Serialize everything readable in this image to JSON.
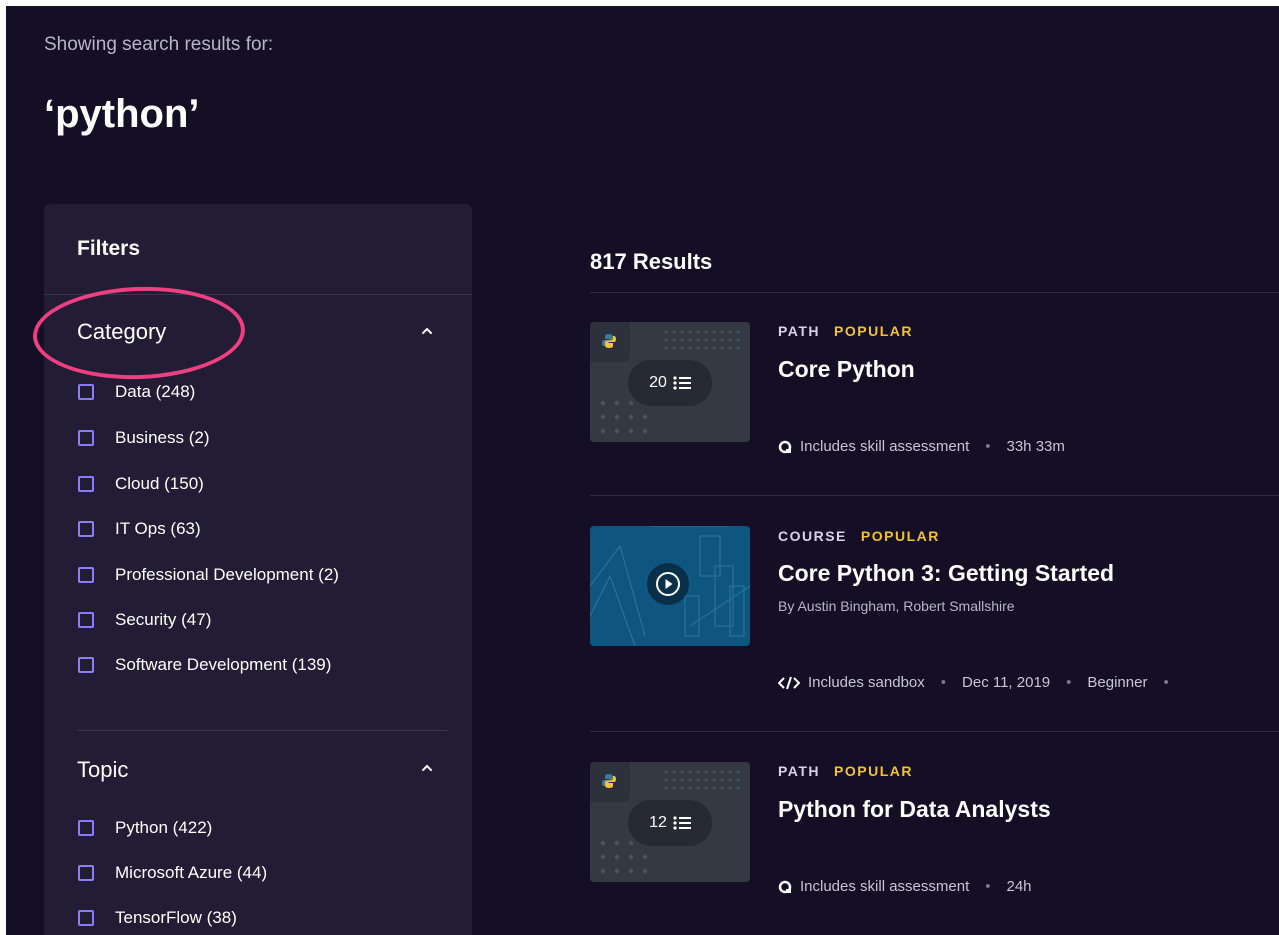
{
  "search": {
    "label": "Showing search results for:",
    "query": "‘python’"
  },
  "filters": {
    "title": "Filters",
    "sections": [
      {
        "title": "Category",
        "options": [
          {
            "label": "Data (248)"
          },
          {
            "label": "Business (2)"
          },
          {
            "label": "Cloud (150)"
          },
          {
            "label": "IT Ops (63)"
          },
          {
            "label": "Professional Development (2)"
          },
          {
            "label": "Security (47)"
          },
          {
            "label": "Software Development (139)"
          }
        ]
      },
      {
        "title": "Topic",
        "options": [
          {
            "label": "Python (422)"
          },
          {
            "label": "Microsoft Azure (44)"
          },
          {
            "label": "TensorFlow (38)"
          }
        ]
      }
    ]
  },
  "results": {
    "count_label": "817 Results",
    "items": [
      {
        "type": "PATH",
        "badge": "POPULAR",
        "title": "Core Python",
        "thumb_count": "20",
        "info": [
          "Includes skill assessment",
          "33h 33m"
        ]
      },
      {
        "type": "COURSE",
        "badge": "POPULAR",
        "title": "Core Python 3: Getting Started",
        "authors": "By Austin Bingham, Robert Smallshire",
        "info": [
          "Includes sandbox",
          "Dec 11, 2019",
          "Beginner"
        ]
      },
      {
        "type": "PATH",
        "badge": "POPULAR",
        "title": "Python for Data Analysts",
        "thumb_count": "12",
        "info": [
          "Includes skill assessment",
          "24h"
        ]
      }
    ]
  },
  "colors": {
    "background": "#140f24",
    "panel": "#221c35",
    "accent": "#8a7dff",
    "popular": "#f2c230",
    "highlight": "#ee3f82"
  },
  "icons": {
    "chevron": "chevron-up-icon",
    "python": "python-logo-icon",
    "list": "list-icon",
    "play": "play-icon",
    "assessment": "skill-assessment-icon",
    "sandbox": "code-icon"
  }
}
